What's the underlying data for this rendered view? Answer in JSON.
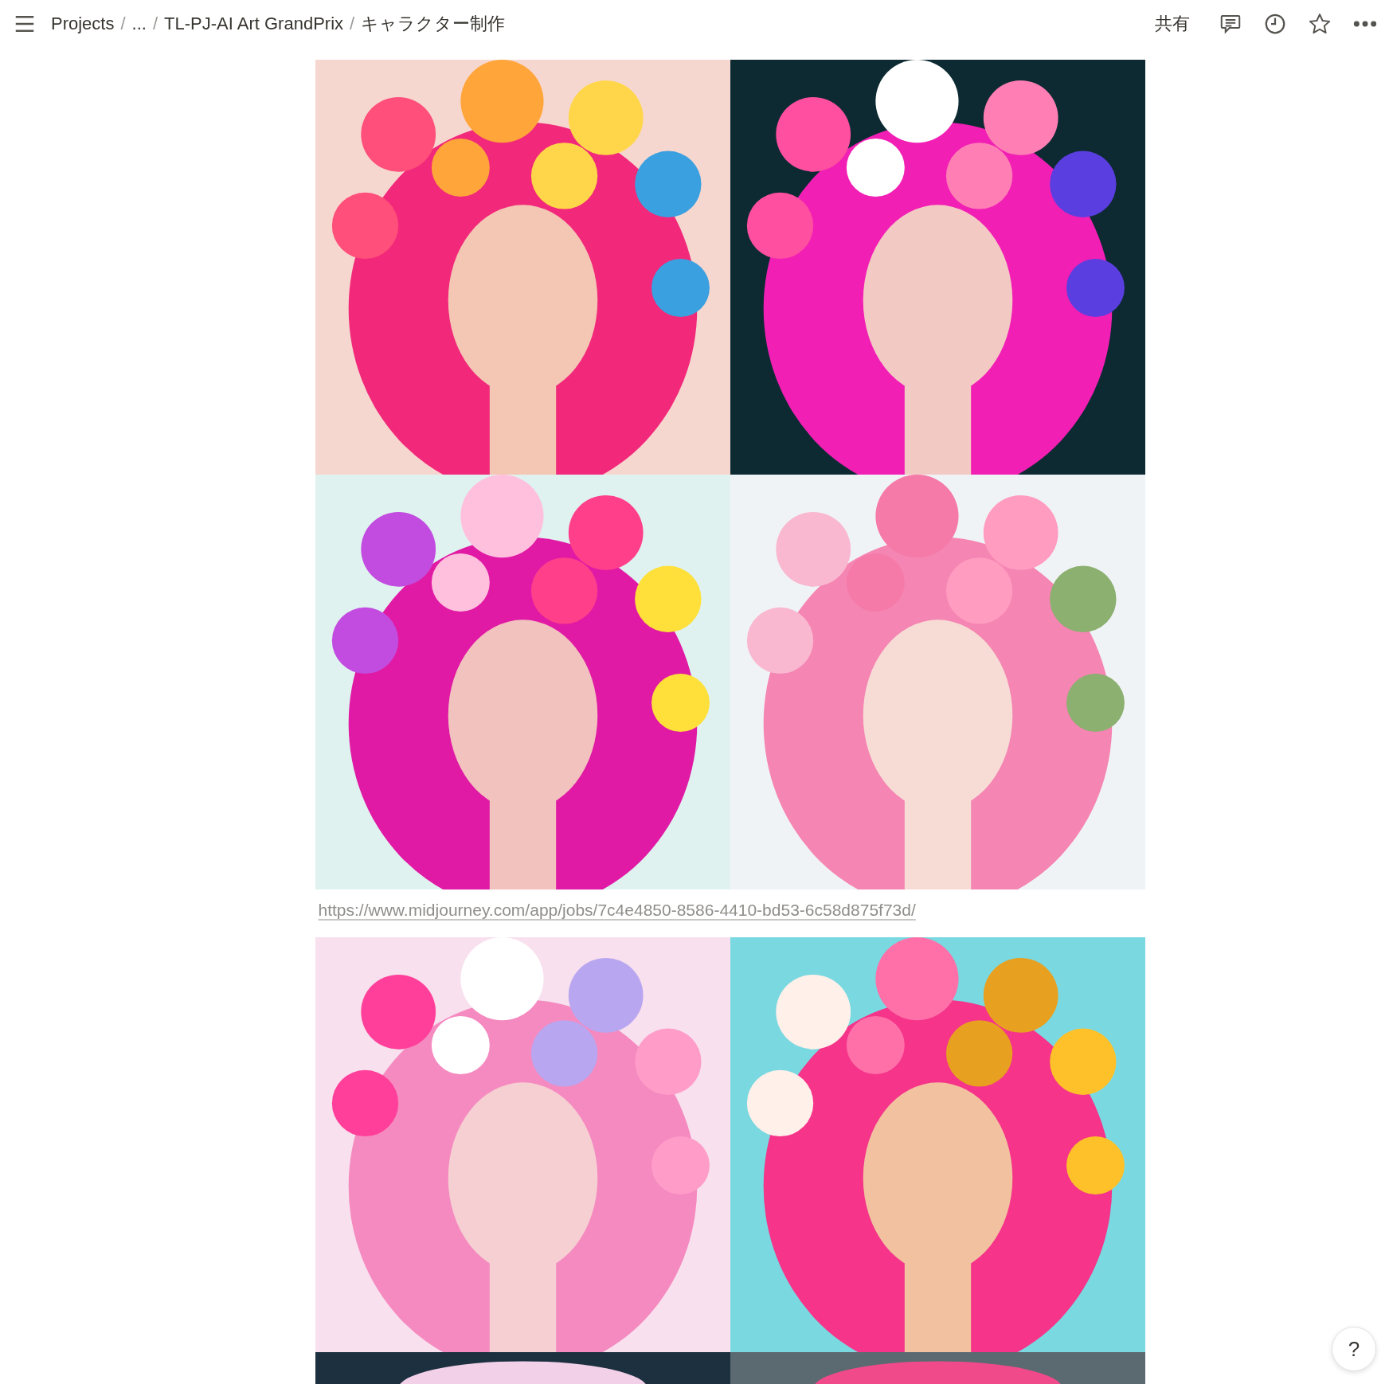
{
  "breadcrumbs": [
    {
      "label": "Projects"
    },
    {
      "label": "..."
    },
    {
      "label": "TL-PJ-AI Art GrandPrix"
    },
    {
      "label": "キャラクター制作"
    }
  ],
  "breadcrumb_separator": "/",
  "topbar": {
    "share": "共有"
  },
  "link": {
    "url": "https://www.midjourney.com/app/jobs/7c4e4850-8586-4410-bd53-6c58d875f73d/"
  },
  "help": "?"
}
